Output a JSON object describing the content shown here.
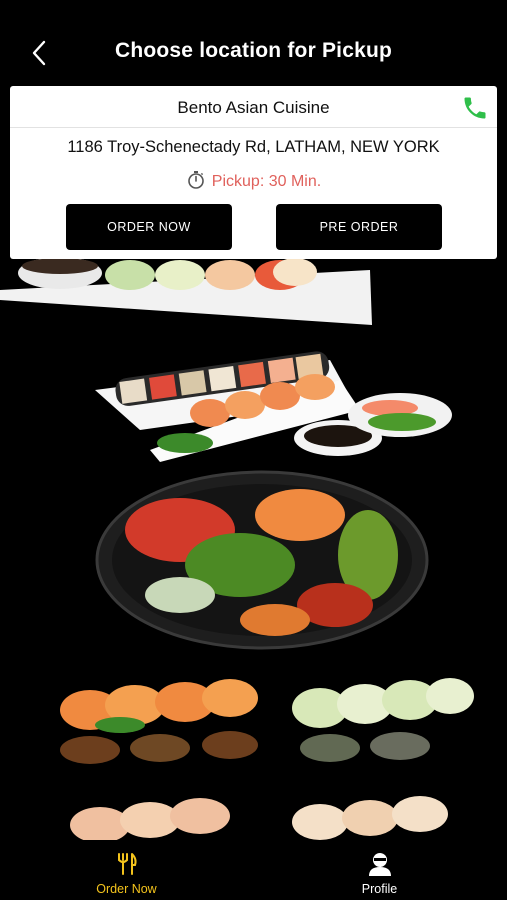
{
  "header": {
    "title": "Choose location for Pickup",
    "back_icon": "chevron-left-icon"
  },
  "location": {
    "name": "Bento Asian Cuisine",
    "address": "1186 Troy-Schenectady Rd, LATHAM, NEW YORK",
    "pickup_text": "Pickup: 30 Min.",
    "phone_icon": "phone-icon",
    "timer_icon": "stopwatch-icon",
    "order_now_label": "ORDER NOW",
    "pre_order_label": "PRE ORDER"
  },
  "tabbar": {
    "items": [
      {
        "label": "Order Now",
        "icon": "cutlery-icon",
        "active": true
      },
      {
        "label": "Profile",
        "icon": "user-icon",
        "active": false
      }
    ]
  },
  "colors": {
    "background": "#000000",
    "active_tab": "#f3c31c",
    "pickup_text": "#e0615c",
    "phone_green": "#2fbf4a"
  }
}
